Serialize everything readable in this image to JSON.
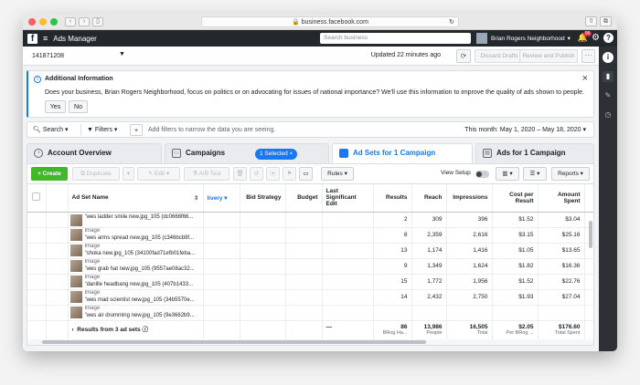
{
  "browser": {
    "url": "business.facebook.com"
  },
  "topbar": {
    "title": "Ads Manager",
    "search_placeholder": "Search business",
    "account_name": "Brian Rogers Neighborhood",
    "notification_count": "99"
  },
  "account_bar": {
    "account_id": "141871208",
    "updated_text": "Updated 22 minutes ago",
    "discard_label": "Discard Drafts",
    "review_label": "Review and Publish"
  },
  "info_banner": {
    "heading": "Additional Information",
    "body": "Does your business, Brian Rogers Neighborhood, focus on politics or on advocating for issues of national importance? We'll use this information to improve the quality of ads shown to people.",
    "yes_label": "Yes",
    "no_label": "No"
  },
  "filter_bar": {
    "search_label": "Search",
    "filters_label": "Filters",
    "add_filters_text": "Add filters to narrow the data you are seeing.",
    "date_range": "This month: May 1, 2020 – May 18, 2020"
  },
  "tabs": {
    "account_overview": "Account Overview",
    "campaigns": "Campaigns",
    "selected_badge": "1 Selected",
    "ad_sets": "Ad Sets for 1 Campaign",
    "ads": "Ads for 1 Campaign"
  },
  "toolbar": {
    "create": "+ Create",
    "duplicate": "Duplicate",
    "edit": "Edit",
    "ab_test": "A/B Test",
    "rules": "Rules",
    "view_setup": "View Setup",
    "reports": "Reports"
  },
  "table": {
    "headers": {
      "name": "Ad Set Name",
      "delivery": "livery",
      "bid_strategy": "Bid Strategy",
      "budget": "Budget",
      "last_edit": "Last Significant Edit",
      "results": "Results",
      "reach": "Reach",
      "impressions": "Impressions",
      "cost_per_result": "Cost per Result",
      "amount_spent": "Amount Spent"
    },
    "rows": [
      {
        "line1": "",
        "line2": "\"wes ladder smile new.jpg_105 (dc0666f66...",
        "results": "2",
        "reach": "309",
        "impressions": "396",
        "cost": "$1.52",
        "spent": "$3.04"
      },
      {
        "line1": "Image",
        "line2": "\"wes arms spread new.jpg_105 (c346bcb9f...",
        "results": "8",
        "reach": "2,359",
        "impressions": "2,616",
        "cost": "$3.15",
        "spent": "$25.16"
      },
      {
        "line1": "Image",
        "line2": "\"shoka new.jpg_105 (34100fad71efb01feba...",
        "results": "13",
        "reach": "1,174",
        "impressions": "1,416",
        "cost": "$1.05",
        "spent": "$13.65"
      },
      {
        "line1": "Image",
        "line2": "\"wes grab hat new.jpg_105 (9557ae08ac32...",
        "results": "9",
        "reach": "1,349",
        "impressions": "1,624",
        "cost": "$1.82",
        "spent": "$16.36"
      },
      {
        "line1": "Image",
        "line2": "\"danille headbang new.jpg_105 (407b1433...",
        "results": "15",
        "reach": "1,772",
        "impressions": "1,956",
        "cost": "$1.52",
        "spent": "$22.76"
      },
      {
        "line1": "Image",
        "line2": "\"wes mad scientist new.jpg_105 (34b5570e...",
        "results": "14",
        "reach": "2,432",
        "impressions": "2,750",
        "cost": "$1.93",
        "spent": "$27.04"
      },
      {
        "line1": "Image",
        "line2": "\"wes air drumming new.jpg_105 (9e3662b9...",
        "results": "",
        "reach": "",
        "impressions": "",
        "cost": "",
        "spent": ""
      }
    ],
    "summary": {
      "label": "Results from 3 ad sets",
      "last_edit": "—",
      "results": "86",
      "results_sub": "BRog Ha...",
      "reach": "13,986",
      "reach_sub": "People",
      "impressions": "16,505",
      "impressions_sub": "Total",
      "cost": "$2.05",
      "cost_sub": "Per BRog ...",
      "spent": "$176.60",
      "spent_sub": "Total Spent"
    }
  }
}
